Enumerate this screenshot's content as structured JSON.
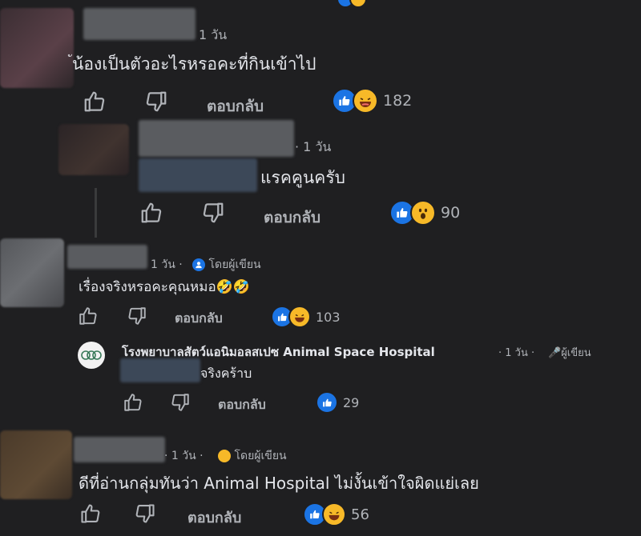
{
  "colors": {
    "background": "#1f1f21",
    "text": "#e4e6eb",
    "muted": "#b0b3b8",
    "like_blue": "#1b74e4",
    "laugh_yellow": "#f7b928"
  },
  "comments": [
    {
      "time": "1 วัน",
      "text": "น้องเป็นตัวอะไรหรอคะที่กินเข้าไป",
      "reply_label": "ตอบกลับ",
      "reactions": [
        "like-icon",
        "laughing-emoji-icon"
      ],
      "reaction_count": "182"
    },
    {
      "time": "· 1 วัน",
      "text": "แรคคูนครับ",
      "reply_label": "ตอบกลับ",
      "reactions": [
        "like-icon",
        "wow-emoji-icon"
      ],
      "reaction_count": "90"
    },
    {
      "time": "1 วัน ·",
      "author_tag": "โดยผู้เขียน",
      "text": "เรื่องจริงหรอคะคุณหมอ🤣🤣",
      "reply_label": "ตอบกลับ",
      "reactions": [
        "like-icon",
        "laughing-emoji-icon"
      ],
      "reaction_count": "103"
    },
    {
      "author": "โรงพยาบาลสัตว์แอนิมอลสเปซ Animal Space Hospital",
      "time": "· 1 วัน ·",
      "author_tag": "ผู้เขียน",
      "text": "จริงคร้าบ",
      "reply_label": "ตอบกลับ",
      "reactions": [
        "like-icon"
      ],
      "reaction_count": "29"
    },
    {
      "time": "· 1 วัน ·",
      "author_tag": "โดยผู้เขียน",
      "text": "ดีที่อ่านกลุ่มทันว่า Animal Hospital ไม่งั้นเข้าใจผิดแย่เลย",
      "reply_label": "ตอบกลับ",
      "reactions": [
        "like-icon",
        "laughing-emoji-icon"
      ],
      "reaction_count": "56"
    }
  ]
}
